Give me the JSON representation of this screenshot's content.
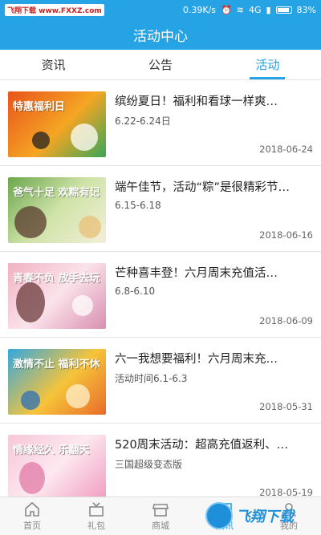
{
  "status_bar": {
    "watermark": "飞翔下载 www.FXXZ.com",
    "speed": "0.39K/s",
    "network": "4G",
    "battery": "83%"
  },
  "header": {
    "title": "活动中心"
  },
  "tabs": [
    {
      "label": "资讯",
      "active": false
    },
    {
      "label": "公告",
      "active": false
    },
    {
      "label": "活动",
      "active": true
    }
  ],
  "activities": [
    {
      "title": "缤纷夏日！福利和看球一样爽…",
      "subtitle": "6.22-6.24日",
      "date": "2018-06-24",
      "thumb_text": "特惠福利日"
    },
    {
      "title": "端午佳节，活动“粽”是很精彩节…",
      "subtitle": "6.15-6.18",
      "date": "2018-06-16",
      "thumb_text": "爸气十足 欢粽有记"
    },
    {
      "title": "芒种喜丰登！六月周末充值活…",
      "subtitle": "6.8-6.10",
      "date": "2018-06-09",
      "thumb_text": "青春不负 放手去玩"
    },
    {
      "title": "六一我想要福利！六月周末充…",
      "subtitle": "活动时间6.1-6.3",
      "date": "2018-05-31",
      "thumb_text": "激情不止 福利不休"
    },
    {
      "title": "520周末活动：超高充值返利、…",
      "subtitle": "三国超级变态版",
      "date": "2018-05-19",
      "thumb_text": "情缘经久 乐翻天"
    }
  ],
  "bottom_nav": [
    {
      "label": "首页",
      "icon": "home-icon",
      "active": false
    },
    {
      "label": "礼包",
      "icon": "gift-icon",
      "active": false
    },
    {
      "label": "商城",
      "icon": "store-icon",
      "active": false
    },
    {
      "label": "资讯",
      "icon": "news-icon",
      "active": true
    },
    {
      "label": "我的",
      "icon": "user-icon",
      "active": false
    }
  ],
  "overlay_watermark": "飞翔下载",
  "colors": {
    "accent": "#26a3e4"
  }
}
